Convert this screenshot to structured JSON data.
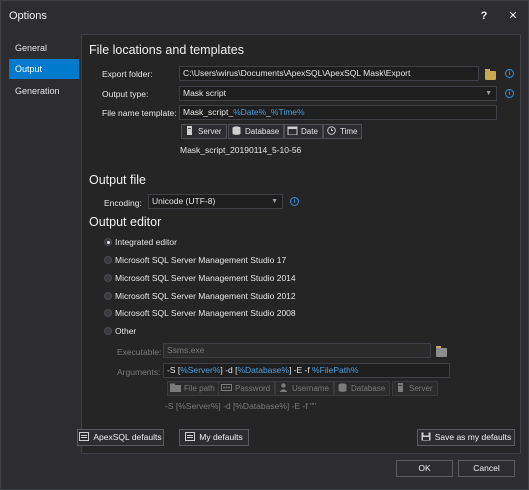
{
  "window": {
    "title": "Options",
    "help_label": "?",
    "close_label": "✕"
  },
  "sidebar": {
    "items": [
      {
        "label": "General",
        "active": false
      },
      {
        "label": "Output",
        "active": true
      },
      {
        "label": "Generation",
        "active": false
      }
    ]
  },
  "file_locations": {
    "heading": "File locations and templates",
    "export_folder_label": "Export folder:",
    "export_folder_value": "C:\\Users\\wirus\\Documents\\ApexSQL\\ApexSQL Mask\\Export",
    "output_type_label": "Output type:",
    "output_type_value": "Mask script",
    "file_name_template_label": "File name template:",
    "template_prefix": "Mask_script_",
    "template_date_token": "%Date%",
    "template_sep": "_",
    "template_time_token": "%Time%",
    "token_buttons": [
      "Server",
      "Database",
      "Date",
      "Time"
    ],
    "preview": "Mask_script_20190114_5-10-56"
  },
  "output_file": {
    "heading": "Output file",
    "encoding_label": "Encoding:",
    "encoding_value": "Unicode (UTF-8)"
  },
  "output_editor": {
    "heading": "Output editor",
    "options": [
      {
        "label": "Integrated editor",
        "selected": true
      },
      {
        "label": "Microsoft SQL Server Management Studio 17",
        "selected": false
      },
      {
        "label": "Microsoft SQL Server Management Studio 2014",
        "selected": false
      },
      {
        "label": "Microsoft SQL Server Management Studio 2012",
        "selected": false
      },
      {
        "label": "Microsoft SQL Server Management Studio 2008",
        "selected": false
      },
      {
        "label": "Other",
        "selected": false
      }
    ],
    "executable_label": "Executable:",
    "executable_value": "Ssms.exe",
    "arguments_label": "Arguments:",
    "args": {
      "s_flag": "-S ",
      "server_token": "%Server%",
      "d_flag": " -d ",
      "database_token": "%Database%",
      "ef_flag": " -E -f ",
      "filepath_token": "%FilePath%"
    },
    "arg_buttons": [
      "File path",
      "Password",
      "Username",
      "Database",
      "Server"
    ],
    "arguments_preview": "-S [%Server%] -d [%Database%] -E -f \"\""
  },
  "footer": {
    "apexsql_defaults": "ApexSQL defaults",
    "my_defaults": "My defaults",
    "save_as_defaults": "Save as my defaults",
    "ok": "OK",
    "cancel": "Cancel"
  },
  "colors": {
    "accent": "#007acc",
    "token": "#4e9fde",
    "background": "#2d2d30",
    "panel": "#252526"
  }
}
